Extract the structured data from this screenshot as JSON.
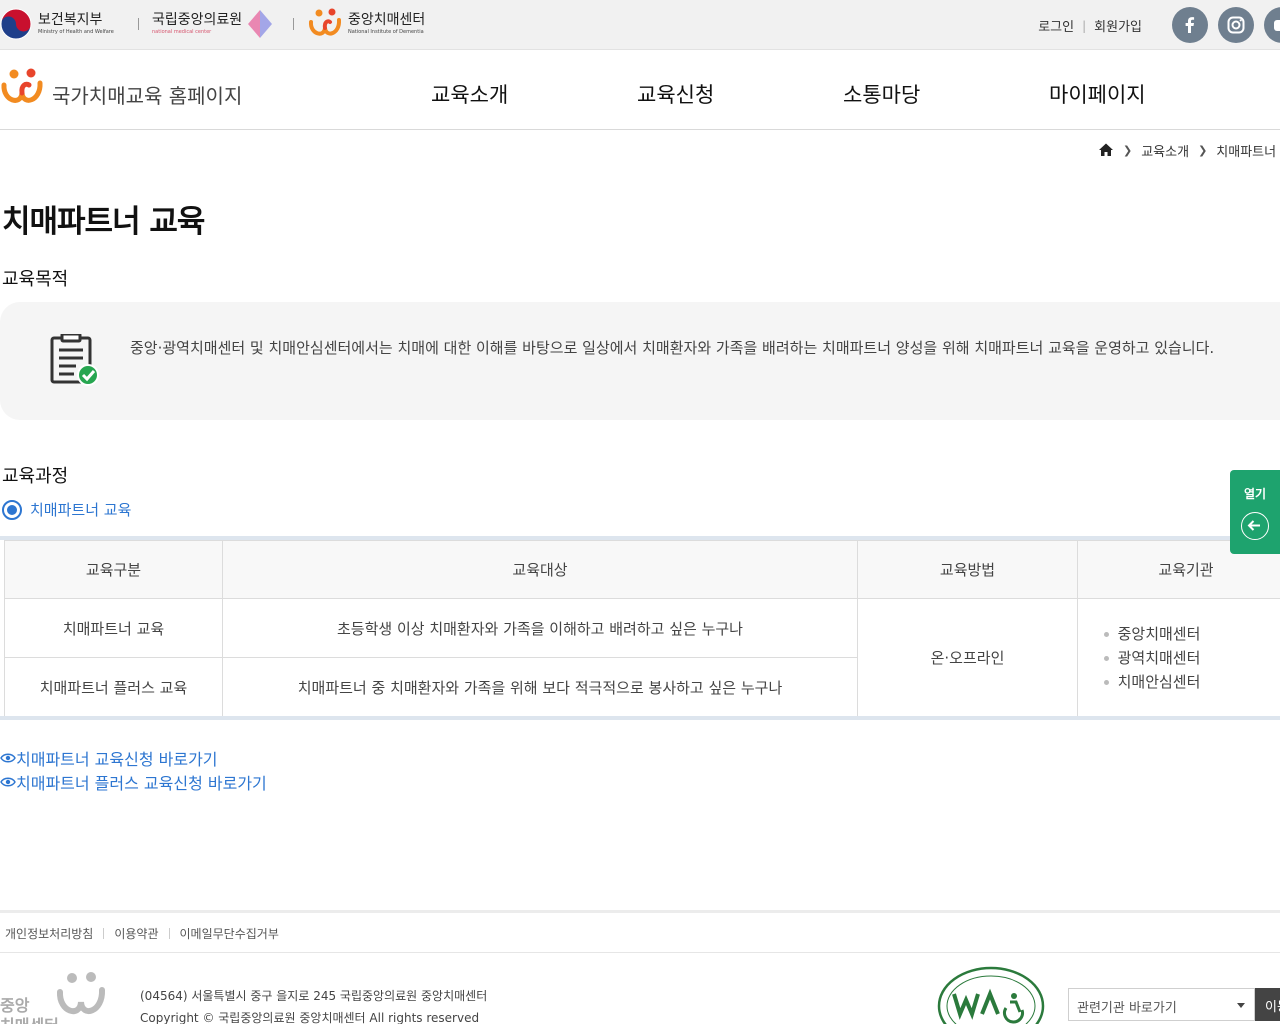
{
  "orgs": {
    "mohw_name": "보건복지부",
    "mohw_sub": "Ministry of Health and Welfare",
    "nmc_name": "국립중앙의료원",
    "nmc_sub": "national medical center",
    "nid_name": "중앙치매센터",
    "nid_sub": "National Institute of Dementia"
  },
  "top_links": {
    "login": "로그인",
    "join": "회원가입"
  },
  "sns": [
    "facebook-icon",
    "instagram-icon",
    "youtube-icon"
  ],
  "site_title": "국가치매교육 홈페이지",
  "menu": [
    "교육소개",
    "교육신청",
    "소통마당",
    "마이페이지"
  ],
  "breadcrumb": {
    "level1": "교육소개",
    "level2": "치매파트너 교"
  },
  "page_title": "치매파트너 교육",
  "purpose": {
    "heading": "교육목적",
    "text": "중앙·광역치매센터 및 치매안심센터에서는 치매에 대한 이해를 바탕으로 일상에서 치매환자와 가족을 배려하는 치매파트너 양성을 위해 치매파트너 교육을 운영하고 있습니다."
  },
  "course": {
    "heading": "교육과정",
    "option": "치매파트너 교육",
    "headers": [
      "교육구분",
      "교육대상",
      "교육방법",
      "교육기관"
    ],
    "rows": [
      {
        "type": "치매파트너 교육",
        "target": "초등학생 이상 치매환자와 가족을 이해하고 배려하고 싶은 누구나"
      },
      {
        "type": "치매파트너 플러스 교육",
        "target": "치매파트너 중 치매환자와 가족을 위해 보다 적극적으로 봉사하고 싶은 누구나"
      }
    ],
    "method": "온·오프라인",
    "institutions": [
      "중앙치매센터",
      "광역치매센터",
      "치매안심센터"
    ]
  },
  "links": [
    "치매파트너 교육신청 바로가기",
    "치매파트너 플러스 교육신청 바로가기"
  ],
  "side_panel": {
    "label": "열기"
  },
  "footer": {
    "links": [
      "개인정보처리방침",
      "이용약관",
      "이메일무단수집거부"
    ],
    "address": "(04564) 서울특별시 중구 을지로 245 국립중앙의료원 중앙치매센터",
    "copyright": "Copyright © 국립중앙의료원 중앙치매센터 All rights reserved",
    "logo_text": [
      "중앙",
      "치매센터"
    ],
    "related_select": "관련기관 바로가기",
    "go_button": "이동"
  },
  "colors": {
    "accent_blue": "#2d76d1",
    "side_green": "#1ea36e",
    "sns_gray": "#6f7f8f"
  }
}
